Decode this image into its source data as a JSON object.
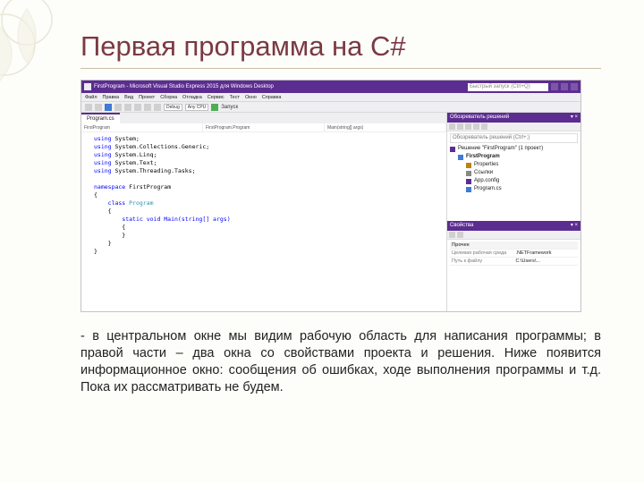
{
  "slide": {
    "title": "Первая программа на C#",
    "body": "- в центральном окне мы видим рабочую область для написания программы; в правой части – два окна со свойствами проекта и решения. Ниже появится информационное окно: сообщения об ошибках, ходе выполнения программы и т.д. Пока их рассматривать не будем."
  },
  "ide": {
    "titlebar": {
      "title": "FirstProgram - Microsoft Visual Studio Express 2015 для Windows Desktop",
      "search_placeholder": "Быстрый запуск (Ctrl+Q)"
    },
    "menu": [
      "Файл",
      "Правка",
      "Вид",
      "Проект",
      "Сборка",
      "Отладка",
      "Сервис",
      "Тест",
      "Окно",
      "Справка"
    ],
    "toolbar": {
      "config": "Debug",
      "platform": "Any CPU",
      "start": "Запуск"
    },
    "editor": {
      "tab": "Program.cs",
      "nav_left": "FirstProgram",
      "nav_mid": "FirstProgram.Program",
      "nav_right": "Main(string[] args)"
    },
    "code": {
      "usings": [
        "System",
        "System.Collections.Generic",
        "System.Linq",
        "System.Text",
        "System.Threading.Tasks"
      ],
      "namespace": "FirstProgram",
      "class": "Program",
      "method_sig": "static void Main(string[] args)"
    },
    "solution": {
      "header": "Обозреватель решений",
      "search_placeholder": "Обозреватель решений (Ctrl+;)",
      "root": "Решение \"FirstProgram\" (1 проект)",
      "project": "FirstProgram",
      "items": {
        "properties": "Properties",
        "references": "Ссылки",
        "appconfig": "App.config",
        "programcs": "Program.cs"
      }
    },
    "properties": {
      "header": "Свойства",
      "target_label": "Целевая рабочая среда",
      "target_value": ".NETFramework",
      "file_label": "Путь к файлу",
      "file_value": "C:\\Users\\..."
    }
  }
}
